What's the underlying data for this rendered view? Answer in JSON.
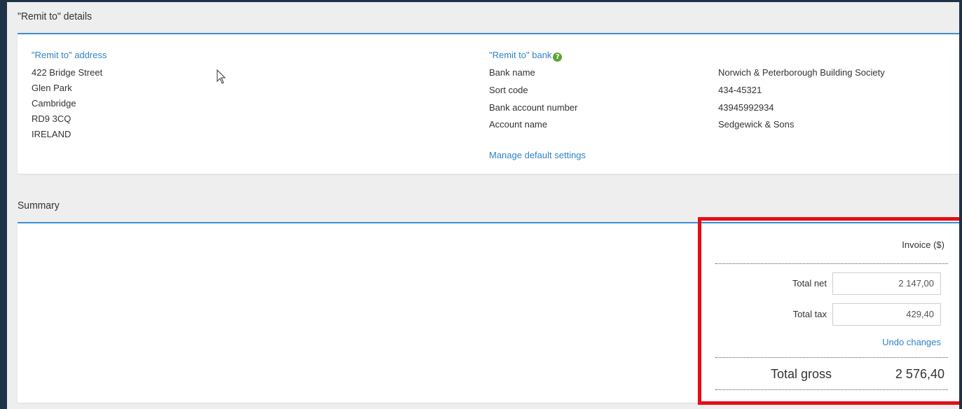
{
  "remit": {
    "title": "\"Remit to\" details",
    "address_heading": "\"Remit to\" address",
    "address_lines": [
      "422 Bridge Street",
      "Glen Park",
      "Cambridge",
      "RD9 3CQ",
      "IRELAND"
    ],
    "bank_heading": "\"Remit to\" bank",
    "bank_rows": [
      {
        "label": "Bank name",
        "value": "Norwich & Peterborough Building Society"
      },
      {
        "label": "Sort code",
        "value": "434-45321"
      },
      {
        "label": "Bank account number",
        "value": "43945992934"
      },
      {
        "label": "Account name",
        "value": "Sedgewick & Sons"
      }
    ],
    "manage_link": "Manage default settings"
  },
  "summary": {
    "title": "Summary",
    "column_header": "Invoice ($)",
    "total_net_label": "Total net",
    "total_net_value": "2 147,00",
    "total_tax_label": "Total tax",
    "total_tax_value": "429,40",
    "undo_link": "Undo changes",
    "total_gross_label": "Total gross",
    "total_gross_value": "2 576,40"
  },
  "colors": {
    "accent": "#3e8ed0",
    "link": "#2f84c7",
    "help_icon": "#5aa631",
    "highlight": "#e30f14",
    "frame": "#1f3247"
  },
  "icons": {
    "help": "question-circle-icon",
    "cursor": "mouse-pointer-icon"
  }
}
